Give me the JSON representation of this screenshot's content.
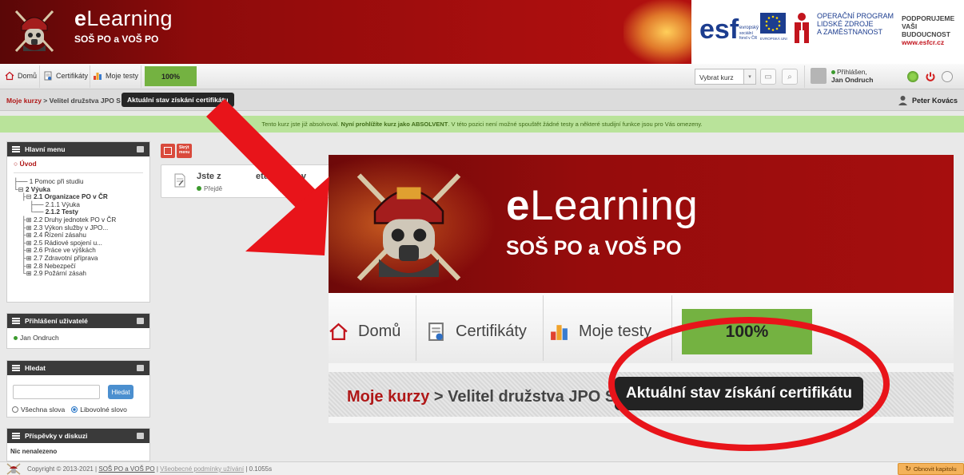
{
  "header": {
    "brand_e": "e",
    "brand_rest": "Learning",
    "subtitle": "SOŠ PO a VOŠ PO",
    "op_line1": "OPERAČNÍ PROGRAM",
    "op_line2": "LIDSKÉ ZDROJE",
    "op_line3": "A ZAMĚSTNANOST",
    "support_line1": "PODPORUJEME",
    "support_line2": "VAŠI BUDOUCNOST",
    "support_url": "www.esfcr.cz",
    "esf_text": "esf"
  },
  "toolbar": {
    "home_label": "Domů",
    "certificates_label": "Certifikáty",
    "tests_label": "Moje testy",
    "progress": "100%",
    "select_course_label": "Vybrat kurz",
    "login_status": "Přihlášen,",
    "login_user": "Jan Ondruch"
  },
  "breadcrumb": {
    "root_label": "Moje kurzy",
    "separator": " > ",
    "current": "Velitel družstva JPO S",
    "tooltip": "Aktuální stav získání certifikátu",
    "user_name": "Peter Kovács"
  },
  "notice": {
    "part1": "Tento kurz jste již absolvoval. ",
    "part2": "Nyní prohlížíte kurz jako ABSOLVENT",
    "part3": ". V této pozici není možné spouštět žádné testy a některé studijní funkce jsou pro Vás omezeny."
  },
  "menu_panel": {
    "title": "Hlavní menu",
    "home": "Úvod",
    "items": [
      {
        "text": "1 Pomoc při studiu",
        "prefix": "├── "
      },
      {
        "text": "2 Výuka",
        "prefix": "└⊟ "
      },
      {
        "text": "2.1 Organizace PO v ČR",
        "prefix": "├⊟ "
      },
      {
        "text": "2.1.1 Výuka",
        "prefix": "├── "
      },
      {
        "text": "2.1.2 Testy",
        "prefix": "└── "
      },
      {
        "text": "2.2 Druhy jednotek PO v ČR",
        "prefix": "├⊞ "
      },
      {
        "text": "2.3 Výkon služby v JPO...",
        "prefix": "├⊞ "
      },
      {
        "text": "2.4 Řízení zásahu",
        "prefix": "├⊞ "
      },
      {
        "text": "2.5 Rádiové spojení u...",
        "prefix": "├⊞ "
      },
      {
        "text": "2.6 Práce ve výškách",
        "prefix": "├⊞ "
      },
      {
        "text": "2.7 Zdravotní příprava",
        "prefix": "├⊞ "
      },
      {
        "text": "2.8 Nebezpečí",
        "prefix": "├⊞ "
      },
      {
        "text": "2.9 Požární zásah",
        "prefix": "└⊞ "
      }
    ]
  },
  "login_panel": {
    "title": "Přihlášení uživatelé",
    "user": "Jan Ondruch"
  },
  "search_panel": {
    "title": "Hledat",
    "button": "Hledat",
    "option_all": "Všechna slova",
    "option_any": "Libovolné slovo"
  },
  "discussion_panel": {
    "title": "Příspěvky v diskuzi",
    "empty": "Nic nenalezeno"
  },
  "main": {
    "hide_menu_line1": "Skrýt",
    "hide_menu_line2": "menu",
    "card_title_left": "Jste z",
    "card_title_right": "etušíte jak v",
    "card_sub_left": "Přejdě",
    "card_sub_right": "ly"
  },
  "zoom": {
    "brand_e": "e",
    "brand_rest": "Learning",
    "subtitle": "SOŠ PO a VOŠ PO",
    "home_label": "Domů",
    "certificates_label": "Certifikáty",
    "tests_label": "Moje testy",
    "progress": "100%",
    "crumb_root": "Moje kurzy",
    "crumb_rest": " > Velitel družstva JPO S",
    "tooltip": "Aktuální stav získání certifikátu"
  },
  "footer": {
    "copyright": "Copyright © 2013-2021 | ",
    "school_link": "SOŠ PO a VOŠ PO",
    "sep": " | ",
    "terms_link": "Všeobecné podmínky užívání",
    "timing": " | 0.1055s",
    "reload_button": "Obnovit kapitolu"
  },
  "colors": {
    "brand_red": "#b01818",
    "progress_green": "#74b241",
    "notice_green": "#b9e39a",
    "annotation_red": "#e8141a",
    "search_blue": "#4b8fcf",
    "reload_orange": "#f4b25a"
  }
}
